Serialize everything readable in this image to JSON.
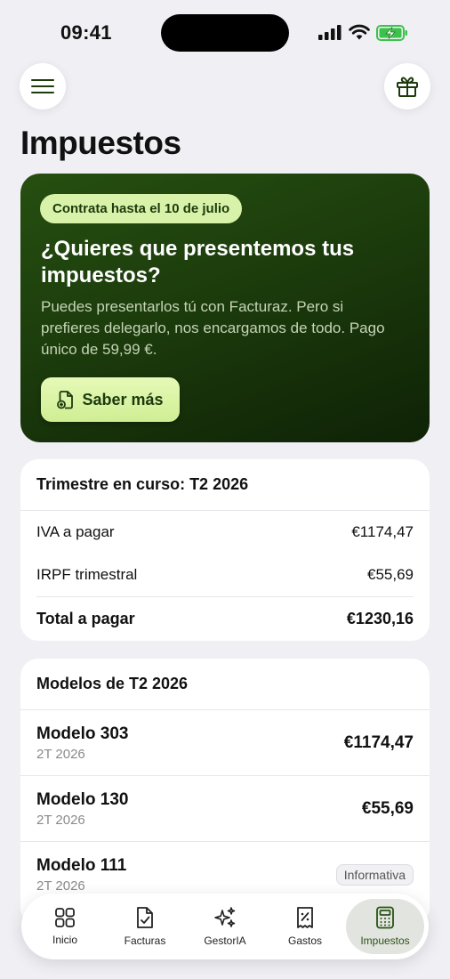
{
  "status_bar": {
    "time": "09:41"
  },
  "header": {
    "menu_icon": "hamburger-icon",
    "gift_icon": "gift-icon",
    "title": "Impuestos"
  },
  "promo": {
    "badge": "Contrata hasta el 10 de julio",
    "title": "¿Quieres que presentemos tus impuestos?",
    "description": "Puedes presentarlos tú con Facturaz. Pero si prefieres delegarlo, nos encargamos de todo. Pago único de 59,99 €.",
    "button_label": "Saber más",
    "button_icon": "document-add-icon"
  },
  "quarter": {
    "header": "Trimestre en curso: T2 2026",
    "rows": [
      {
        "label": "IVA a pagar",
        "value": "€1174,47"
      },
      {
        "label": "IRPF trimestral",
        "value": "€55,69"
      }
    ],
    "total": {
      "label": "Total a pagar",
      "value": "€1230,16"
    }
  },
  "models": {
    "header": "Modelos de T2 2026",
    "items": [
      {
        "name": "Modelo 303",
        "period": "2T 2026",
        "amount": "€1174,47"
      },
      {
        "name": "Modelo 130",
        "period": "2T 2026",
        "amount": "€55,69"
      },
      {
        "name": "Modelo 111",
        "period": "2T 2026",
        "badge": "Informativa"
      }
    ]
  },
  "tab_bar": {
    "tabs": [
      {
        "label": "Inicio",
        "icon": "grid-icon"
      },
      {
        "label": "Facturas",
        "icon": "invoice-check-icon"
      },
      {
        "label": "GestorIA",
        "icon": "sparkles-icon"
      },
      {
        "label": "Gastos",
        "icon": "receipt-percent-icon"
      },
      {
        "label": "Impuestos",
        "icon": "calculator-icon",
        "active": true
      }
    ]
  },
  "colors": {
    "promo_bg": "#1b3a0c",
    "accent_light": "#d8f3a9",
    "page_bg": "#efeff4"
  }
}
